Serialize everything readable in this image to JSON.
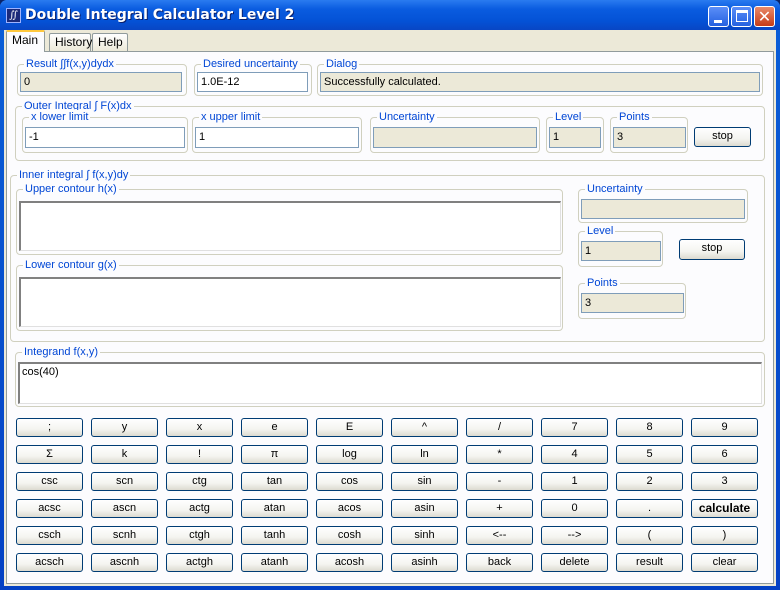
{
  "window": {
    "title": "Double Integral Calculator Level 2",
    "icon": "integral-app-icon",
    "controls": {
      "minimize": "minimize",
      "maximize": "maximize",
      "close": "close"
    }
  },
  "tabs": [
    {
      "label": "Main",
      "active": true
    },
    {
      "label": "History",
      "active": false
    },
    {
      "label": "Help",
      "active": false
    }
  ],
  "result": {
    "label": "Result  ∫∫f(x,y)dydx",
    "value": "0"
  },
  "desired_uncertainty": {
    "label": "Desired uncertainty",
    "value": "1.0E-12"
  },
  "dialog": {
    "label": "Dialog",
    "value": "Successfully calculated."
  },
  "outer": {
    "label": "Outer Integral  ∫ F(x)dx",
    "x_lower": {
      "label": "x lower limit",
      "value": "-1"
    },
    "x_upper": {
      "label": "x upper limit",
      "value": "1"
    },
    "uncertainty": {
      "label": "Uncertainty",
      "value": ""
    },
    "level": {
      "label": "Level",
      "value": "1"
    },
    "points": {
      "label": "Points",
      "value": "3"
    },
    "stop_label": "stop"
  },
  "inner": {
    "label": "Inner integral  ∫ f(x,y)dy",
    "upper_contour": {
      "label": "Upper contour h(x)",
      "value": ""
    },
    "lower_contour": {
      "label": "Lower contour g(x)",
      "value": ""
    },
    "uncertainty": {
      "label": "Uncertainty",
      "value": ""
    },
    "level": {
      "label": "Level",
      "value": "1"
    },
    "points": {
      "label": "Points",
      "value": "3"
    },
    "stop_label": "stop"
  },
  "integrand": {
    "label": "Integrand f(x,y)",
    "value": "cos(40)"
  },
  "keypad": [
    [
      ";",
      "y",
      "x",
      "e",
      "E",
      "^",
      "/",
      "7",
      "8",
      "9"
    ],
    [
      "Σ",
      "k",
      "!",
      "π",
      "log",
      "ln",
      "*",
      "4",
      "5",
      "6"
    ],
    [
      "csc",
      "scn",
      "ctg",
      "tan",
      "cos",
      "sin",
      "-",
      "1",
      "2",
      "3"
    ],
    [
      "acsc",
      "ascn",
      "actg",
      "atan",
      "acos",
      "asin",
      "+",
      "0",
      ".",
      "calculate"
    ],
    [
      "csch",
      "scnh",
      "ctgh",
      "tanh",
      "cosh",
      "sinh",
      "<--",
      "-->",
      "(",
      ")"
    ],
    [
      "acsch",
      "ascnh",
      "actgh",
      "atanh",
      "acosh",
      "asinh",
      "back",
      "delete",
      "result",
      "clear"
    ]
  ]
}
